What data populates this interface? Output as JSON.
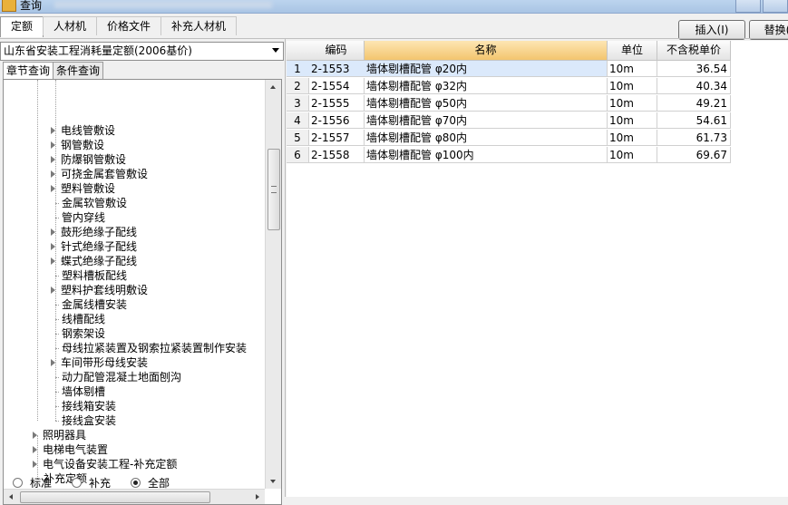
{
  "window": {
    "title": "查询"
  },
  "tabs": [
    {
      "label": "定额",
      "active": true
    },
    {
      "label": "人材机",
      "active": false
    },
    {
      "label": "价格文件",
      "active": false
    },
    {
      "label": "补充人材机",
      "active": false
    }
  ],
  "toolbar": {
    "insert_label": "插入(I)",
    "replace_label": "替换("
  },
  "left": {
    "quota_select": "山东省安装工程消耗量定额(2006基价)",
    "subtabs": [
      {
        "label": "章节查询",
        "active": true
      },
      {
        "label": "条件查询",
        "active": false
      }
    ],
    "tree_items": [
      {
        "label": "电线管敷设",
        "expandable": true,
        "level": 2
      },
      {
        "label": "钢管敷设",
        "expandable": true,
        "level": 2
      },
      {
        "label": "防爆钢管敷设",
        "expandable": true,
        "level": 2
      },
      {
        "label": "可挠金属套管敷设",
        "expandable": true,
        "level": 2
      },
      {
        "label": "塑料管敷设",
        "expandable": true,
        "level": 2
      },
      {
        "label": "金属软管敷设",
        "expandable": false,
        "level": 2
      },
      {
        "label": "管内穿线",
        "expandable": false,
        "level": 2
      },
      {
        "label": "鼓形绝缘子配线",
        "expandable": true,
        "level": 2
      },
      {
        "label": "针式绝缘子配线",
        "expandable": true,
        "level": 2
      },
      {
        "label": "蝶式绝缘子配线",
        "expandable": true,
        "level": 2
      },
      {
        "label": "塑料槽板配线",
        "expandable": false,
        "level": 2
      },
      {
        "label": "塑料护套线明敷设",
        "expandable": true,
        "level": 2
      },
      {
        "label": "金属线槽安装",
        "expandable": false,
        "level": 2
      },
      {
        "label": "线槽配线",
        "expandable": false,
        "level": 2
      },
      {
        "label": "钢索架设",
        "expandable": false,
        "level": 2
      },
      {
        "label": "母线拉紧装置及钢索拉紧装置制作安装",
        "expandable": false,
        "level": 2
      },
      {
        "label": "车间带形母线安装",
        "expandable": true,
        "level": 2
      },
      {
        "label": "动力配管混凝土地面刨沟",
        "expandable": false,
        "level": 2
      },
      {
        "label": "墙体剔槽",
        "expandable": false,
        "level": 2
      },
      {
        "label": "接线箱安装",
        "expandable": false,
        "level": 2
      },
      {
        "label": "接线盒安装",
        "expandable": false,
        "level": 2
      },
      {
        "label": "照明器具",
        "expandable": true,
        "level": 1
      },
      {
        "label": "电梯电气装置",
        "expandable": true,
        "level": 1
      },
      {
        "label": "电气设备安装工程-补充定额",
        "expandable": true,
        "level": 1
      },
      {
        "label": "补充定额",
        "expandable": false,
        "level": 1
      }
    ],
    "filters": [
      {
        "label": "标准",
        "checked": false
      },
      {
        "label": "补充",
        "checked": false
      },
      {
        "label": "全部",
        "checked": true
      }
    ]
  },
  "grid": {
    "columns": {
      "code": "编码",
      "name": "名称",
      "unit": "单位",
      "price": "不含税单价"
    },
    "rows": [
      {
        "idx": "1",
        "code": "2-1553",
        "name": "墙体剔槽配管  φ20内",
        "unit": "10m",
        "price": "36.54"
      },
      {
        "idx": "2",
        "code": "2-1554",
        "name": "墙体剔槽配管  φ32内",
        "unit": "10m",
        "price": "40.34"
      },
      {
        "idx": "3",
        "code": "2-1555",
        "name": "墙体剔槽配管  φ50内",
        "unit": "10m",
        "price": "49.21"
      },
      {
        "idx": "4",
        "code": "2-1556",
        "name": "墙体剔槽配管  φ70内",
        "unit": "10m",
        "price": "54.61"
      },
      {
        "idx": "5",
        "code": "2-1557",
        "name": "墙体剔槽配管  φ80内",
        "unit": "10m",
        "price": "61.73"
      },
      {
        "idx": "6",
        "code": "2-1558",
        "name": "墙体剔槽配管  φ100内",
        "unit": "10m",
        "price": "69.67"
      }
    ]
  }
}
